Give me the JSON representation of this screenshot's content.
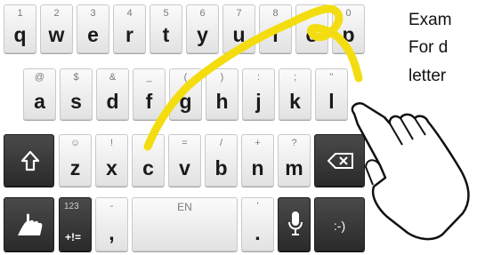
{
  "side_text": {
    "line1": "Exam",
    "line2": "For d",
    "line3": "letter"
  },
  "rows": [
    {
      "name": "row-top",
      "keys": [
        {
          "main": "q",
          "sub": "1"
        },
        {
          "main": "w",
          "sub": "2"
        },
        {
          "main": "e",
          "sub": "3"
        },
        {
          "main": "r",
          "sub": "4"
        },
        {
          "main": "t",
          "sub": "5"
        },
        {
          "main": "y",
          "sub": "6"
        },
        {
          "main": "u",
          "sub": "7"
        },
        {
          "main": "i",
          "sub": "8"
        },
        {
          "main": "o",
          "sub": "9"
        },
        {
          "main": "p",
          "sub": "0"
        }
      ]
    },
    {
      "name": "row-middle",
      "keys": [
        {
          "main": "a",
          "sub": "@"
        },
        {
          "main": "s",
          "sub": "$"
        },
        {
          "main": "d",
          "sub": "&"
        },
        {
          "main": "f",
          "sub": "_"
        },
        {
          "main": "g",
          "sub": "("
        },
        {
          "main": "h",
          "sub": ")"
        },
        {
          "main": "j",
          "sub": ":"
        },
        {
          "main": "k",
          "sub": ";"
        },
        {
          "main": "l",
          "sub": "\""
        }
      ]
    },
    {
      "name": "row-bottom",
      "keys": [
        {
          "main": "z",
          "sub": "☺"
        },
        {
          "main": "x",
          "sub": "!"
        },
        {
          "main": "c",
          "sub": "#"
        },
        {
          "main": "v",
          "sub": "="
        },
        {
          "main": "b",
          "sub": "/"
        },
        {
          "main": "n",
          "sub": "+"
        },
        {
          "main": "m",
          "sub": "?"
        }
      ]
    }
  ],
  "bottom_row": {
    "symbols_sub": "123",
    "symbols_main": "+!=",
    "comma_sub": "-",
    "comma_main": ",",
    "space_label": "EN",
    "period_sub": "'",
    "period_main": ".",
    "emoji_label": ":-)"
  },
  "icons": {
    "shift": "shift-icon",
    "backspace": "backspace-icon",
    "swype": "swype-hand-icon",
    "mic": "microphone-icon",
    "pointer": "pointing-hand-icon"
  },
  "colors": {
    "trace": "#f3dd10",
    "dark_key": "#2e2e2e"
  }
}
